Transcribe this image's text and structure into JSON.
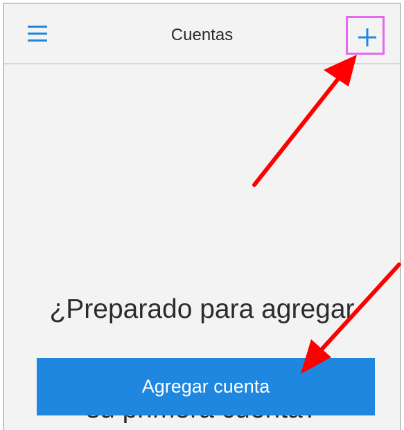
{
  "header": {
    "title": "Cuentas",
    "menu_icon": "hamburger-menu-icon",
    "add_icon": "plus-icon"
  },
  "main": {
    "prompt_line_1": "¿Preparado para agregar",
    "prompt_line_2": "su primera cuenta?",
    "add_account_label": "Agregar cuenta"
  },
  "theme": {
    "accent": "#1f87df",
    "background": "#f3f3f3",
    "highlight_box": "#e667f0",
    "annotation_arrow": "#ff0000"
  },
  "annotations": {
    "arrow_count": 2,
    "highlighted_control": "add-account-icon-button"
  }
}
